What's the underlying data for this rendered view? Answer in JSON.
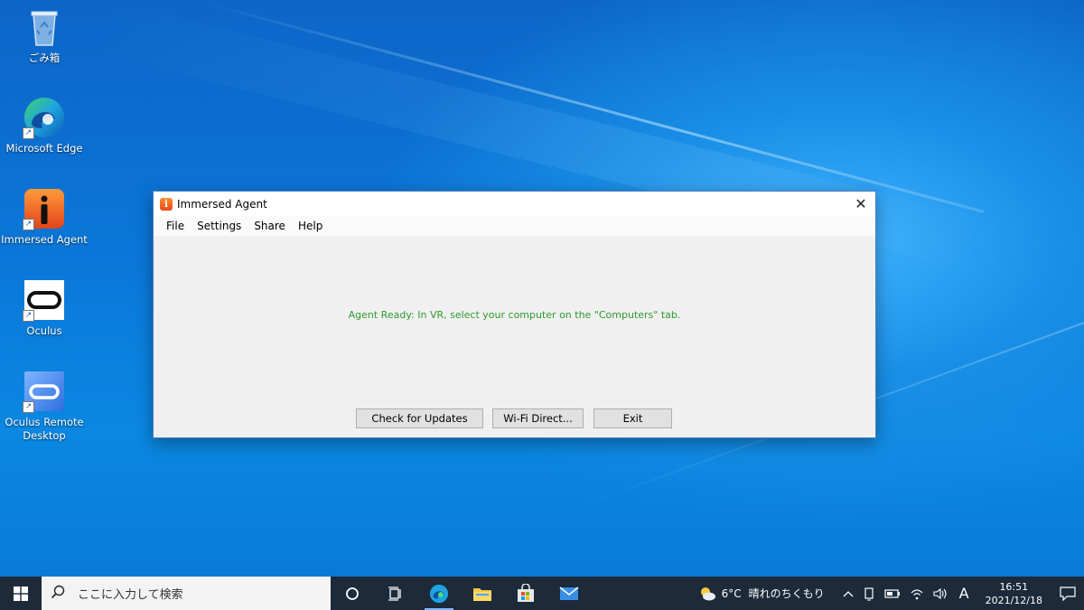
{
  "desktop": {
    "icons": [
      {
        "label": "ごみ箱"
      },
      {
        "label": "Microsoft Edge"
      },
      {
        "label": "Immersed Agent"
      },
      {
        "label": "Oculus"
      },
      {
        "label": "Oculus Remote Desktop"
      }
    ]
  },
  "window": {
    "title": "Immersed Agent",
    "app_icon_letter": "i",
    "close_glyph": "✕",
    "menu": [
      "File",
      "Settings",
      "Share",
      "Help"
    ],
    "status_message": "Agent Ready: In VR, select your computer on the \"Computers\" tab.",
    "status_color": "#2e9a2e",
    "buttons": {
      "check_updates": "Check for Updates",
      "wifi_direct": "Wi-Fi Direct...",
      "exit": "Exit"
    }
  },
  "taskbar": {
    "search_placeholder": "ここに入力して検索",
    "weather": {
      "temp": "6°C",
      "condition": "晴れのちくもり"
    },
    "ime": "A",
    "clock": {
      "time": "16:51",
      "date": "2021/12/18"
    },
    "tray_chevron": "^"
  },
  "colors": {
    "accent": "#0078d7",
    "taskbar": "#1c2a3a"
  }
}
